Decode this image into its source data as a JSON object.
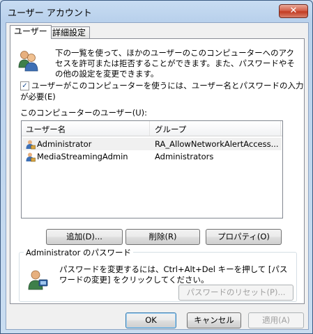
{
  "window": {
    "title": "ユーザー アカウント",
    "close_glyph": "✕"
  },
  "tabs": [
    {
      "label": "ユーザー"
    },
    {
      "label": "詳細設定"
    }
  ],
  "users_tab": {
    "intro_text": "下の一覧を使って、ほかのユーザーのこのコンピューターへのアクセスを許可または拒否することができます。また、パスワードやその他の設定を変更できます。",
    "require_login_checkbox": {
      "label": "ユーザーがこのコンピューターを使うには、ユーザー名とパスワードの入力が必要(E)",
      "checked": true
    },
    "users_list_label": "このコンピューターのユーザー(U):",
    "columns": [
      "ユーザー名",
      "グループ"
    ],
    "rows": [
      {
        "name": "Administrator",
        "group": "RA_AllowNetworkAlertAccess..."
      },
      {
        "name": "MediaStreamingAdmin",
        "group": "Administrators"
      }
    ],
    "buttons": {
      "add": "追加(D)...",
      "remove": "削除(R)",
      "properties": "プロパティ(O)"
    },
    "password_group": {
      "legend": "Administrator のパスワード",
      "text": "パスワードを変更するには、Ctrl+Alt+Del キーを押して [パスワードの変更] をクリックしてください。",
      "reset_button": "パスワードのリセット(P)..."
    }
  },
  "footer": {
    "ok": "OK",
    "cancel": "キャンセル",
    "apply": "適用(A)"
  },
  "colors": {
    "title_bg": "#c8dcf2",
    "close_red": "#c23c23",
    "selected_row": "#f0f0f0"
  },
  "icons": [
    "users-icon",
    "user-icon",
    "password-user-icon",
    "close-icon",
    "check-icon"
  ]
}
